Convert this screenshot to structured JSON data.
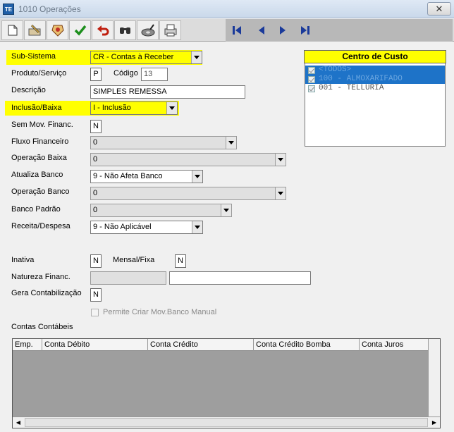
{
  "window": {
    "title": "1010 Operações",
    "icon_text": "TE",
    "close_label": "✕"
  },
  "toolbar": {
    "buttons": [
      "new-icon",
      "edit-icon",
      "settings-icon",
      "confirm-icon",
      "undo-icon",
      "search-icon",
      "disk-icon",
      "print-icon"
    ],
    "nav": [
      "first-icon",
      "prev-icon",
      "next-icon",
      "last-icon"
    ]
  },
  "form": {
    "subsistema_label": "Sub-Sistema",
    "subsistema_value": "CR - Contas à Receber",
    "produto_label": "Produto/Serviço",
    "produto_value": "P",
    "codigo_label": "Código",
    "codigo_value": "13",
    "descricao_label": "Descrição",
    "descricao_value": "SIMPLES REMESSA",
    "inclusao_label": "Inclusão/Baixa",
    "inclusao_value": "I - Inclusão",
    "semmov_label": "Sem Mov. Financ.",
    "semmov_value": "N",
    "fluxo_label": "Fluxo Financeiro",
    "fluxo_value": "0",
    "opbaixa_label": "Operação Baixa",
    "opbaixa_value": "0",
    "atualiza_label": "Atualiza Banco",
    "atualiza_value": "9 - Não Afeta Banco",
    "opbanco_label": "Operação Banco",
    "opbanco_value": "0",
    "bancopadrao_label": "Banco Padrão",
    "bancopadrao_value": "0",
    "receita_label": "Receita/Despesa",
    "receita_value": "9 - Não Aplicável",
    "inativa_label": "Inativa",
    "inativa_value": "N",
    "mensal_label": "Mensal/Fixa",
    "mensal_value": "N",
    "natureza_label": "Natureza Financ.",
    "natureza_code": "",
    "natureza_desc": "",
    "gera_label": "Gera Contabilização",
    "gera_value": "N",
    "permite_label": "Permite Criar Mov.Banco Manual",
    "contas_label": "Contas Contábeis"
  },
  "centro_custo": {
    "title": "Centro de Custo",
    "items": [
      "<TODOS>",
      "100 - ALMOXARIFADO",
      "001 - TELLURIA"
    ]
  },
  "grid": {
    "columns": [
      "Emp.",
      "Conta Débito",
      "Conta Crédito",
      "Conta Crédito Bomba",
      "Conta Juros"
    ]
  }
}
